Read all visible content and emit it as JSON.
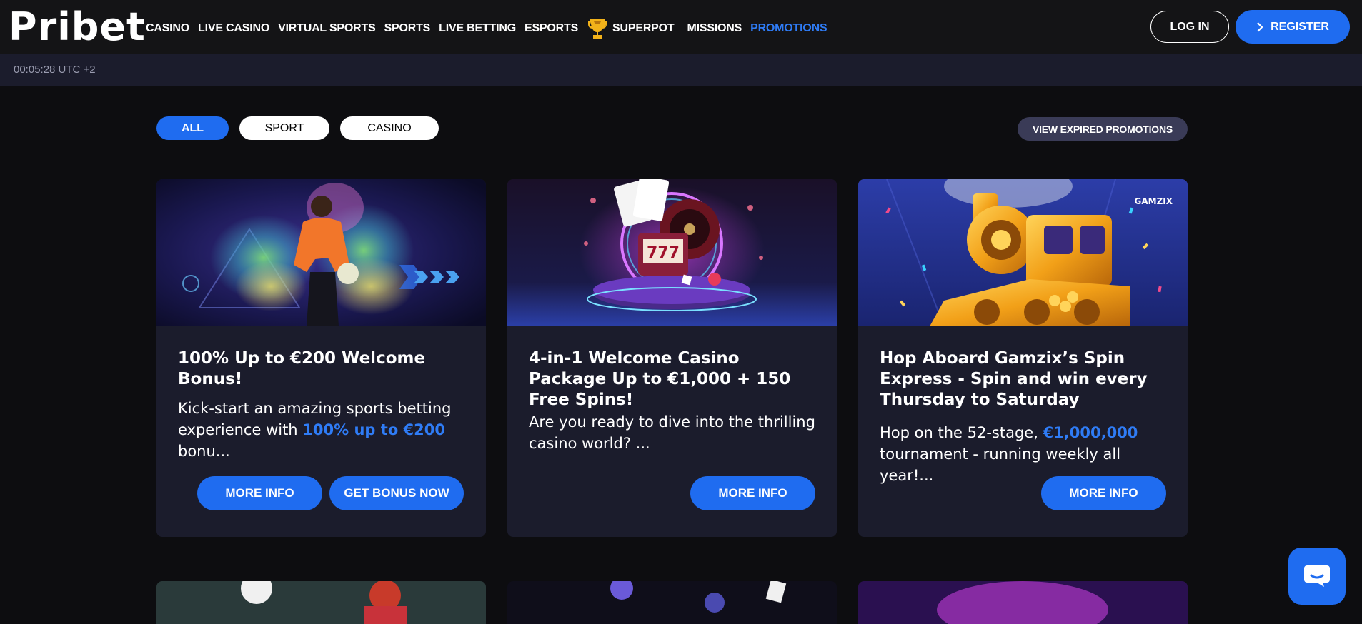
{
  "header": {
    "logo": "Pribet",
    "nav": [
      "CASINO",
      "LIVE CASINO",
      "VIRTUAL SPORTS",
      "SPORTS",
      "LIVE BETTING",
      "ESPORTS"
    ],
    "superpot": "SUPERPOT",
    "missions": "MISSIONS",
    "promotions": "PROMOTIONS",
    "login": "LOG IN",
    "register": "REGISTER"
  },
  "timebar": {
    "time": "00:05:28 UTC +2"
  },
  "filters": {
    "all": "ALL",
    "sport": "SPORT",
    "casino": "CASINO",
    "expired": "VIEW EXPIRED PROMOTIONS"
  },
  "cards": [
    {
      "title": "100% Up to €200 Welcome Bonus!",
      "desc_pre": "Kick-start an amazing sports betting experience with ",
      "desc_hl": "100% up to €200",
      "desc_post": " bonu...",
      "more_info": "MORE INFO",
      "get_bonus": "GET BONUS NOW"
    },
    {
      "title": "4-in-1 Welcome Casino Package Up to €1,000 + 150 Free Spins!",
      "desc": "Are you ready to dive into the thrilling casino world? ...",
      "more_info": "MORE INFO",
      "image_text": "777"
    },
    {
      "title": "Hop Aboard Gamzix’s Spin Express - Spin and win every Thursday to Saturday",
      "desc_pre": "Hop on the 52-stage, ",
      "desc_hl": "€1,000,000",
      "desc_post": " tournament - running weekly all year!...",
      "more_info": "MORE INFO",
      "brand": "GAMZIX"
    }
  ],
  "colors": {
    "accent": "#1f6cf0",
    "header_bg": "#141416",
    "card_bg": "#1b1c2c",
    "page_bg": "#0d0d10"
  },
  "icons": {
    "trophy": "trophy-icon",
    "chevron": "chevron-right-icon",
    "chat": "chat-icon"
  }
}
